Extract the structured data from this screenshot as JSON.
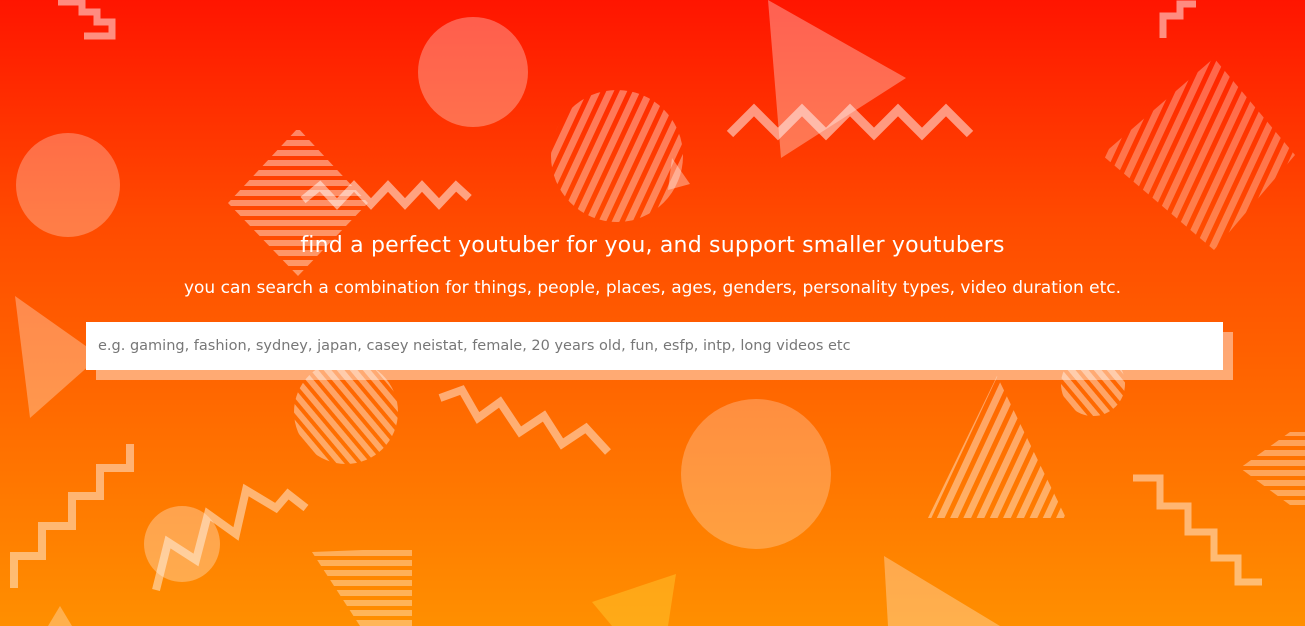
{
  "hero": {
    "headline": "find a perfect youtuber for you, and support smaller youtubers",
    "subline": "you can search a combination for things, people, places, ages, genders, personality types, video duration etc.",
    "gradient_top": "#ff1500",
    "gradient_bottom": "#ff8f00"
  },
  "search": {
    "placeholder": "e.g. gaming, fashion, sydney, japan, casey neistat, female, 20 years old, fun, esfp, intp, long videos etc",
    "value": ""
  },
  "decorations": {
    "shape_color": "#ffffff",
    "shapes": [
      "circle",
      "triangle",
      "zigzag",
      "striped-circle",
      "striped-diamond",
      "striped-triangle",
      "step-line"
    ]
  }
}
